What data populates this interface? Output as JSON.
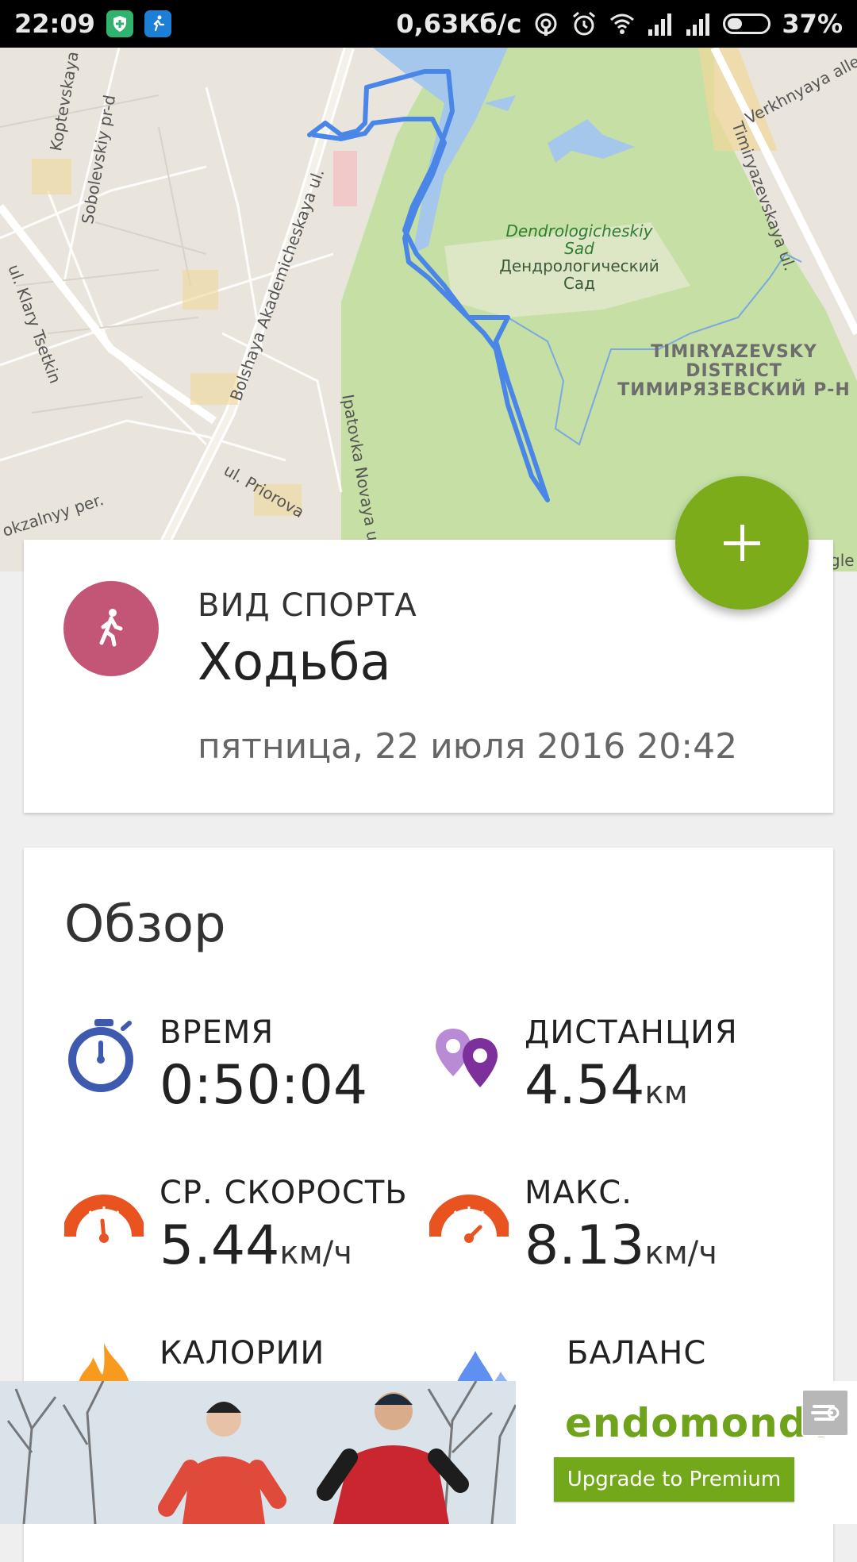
{
  "status_bar": {
    "time": "22:09",
    "network_speed": "0,63Кб/с",
    "battery_percent": "37%",
    "battery_level": 0.37,
    "icons": [
      "shield-plus-icon",
      "runner-app-icon",
      "hotspot-icon",
      "alarm-icon",
      "wifi-icon",
      "signal-icon",
      "signal-icon",
      "battery-icon"
    ]
  },
  "map": {
    "streets": [
      "Koptevskaya ul.",
      "Sobolevskiy pr-d",
      "ul. Klary Tsetkin",
      "Bolshaya Akademicheskaya ul.",
      "Ipatovka Novaya ul.",
      "ul. Priorova",
      "okzalnyy per.",
      "Verkhnyaya alleya",
      "Timiryazevskaya ul."
    ],
    "park_label_latin": [
      "Dendrologicheskiy",
      "Sad"
    ],
    "park_label_cyrillic": [
      "Дендрологический",
      "Сад"
    ],
    "district_label": [
      "TIMIRYAZEVSKY",
      "DISTRICT",
      "ТИМИРЯЗЕВСКИЙ Р-Н"
    ],
    "attribution_fragment": "gle",
    "route_color": "#4a86e8"
  },
  "fab": {
    "icon": "plus-icon",
    "color": "#7cac1a"
  },
  "sport_card": {
    "caption": "ВИД СПОРТА",
    "sport": "Ходьба",
    "date": "пятница, 22 июля 2016 20:42",
    "icon": "walking-person-icon",
    "icon_color": "#c35676"
  },
  "overview": {
    "title": "Обзор",
    "stats": [
      {
        "label": "ВРЕМЯ",
        "value": "0:50:04",
        "unit": "",
        "icon": "stopwatch-icon"
      },
      {
        "label": "ДИСТАНЦИЯ",
        "value": "4.54",
        "unit": "км",
        "icon": "location-pins-icon"
      },
      {
        "label": "СР. СКОРОСТЬ",
        "value": "5.44",
        "unit": "км/ч",
        "icon": "speedometer-icon"
      },
      {
        "label": "МАКС.",
        "value": "8.13",
        "unit": "км/ч",
        "icon": "speedometer-max-icon"
      },
      {
        "label": "КАЛОРИИ",
        "value": "",
        "unit": "",
        "icon": "flame-icon"
      },
      {
        "label": "БАЛАНС",
        "value": "",
        "unit": "",
        "icon": "water-drops-icon"
      }
    ]
  },
  "ad": {
    "brand": "endomondo",
    "button_label": "Upgrade to Premium",
    "brand_color": "#6fa31b"
  }
}
